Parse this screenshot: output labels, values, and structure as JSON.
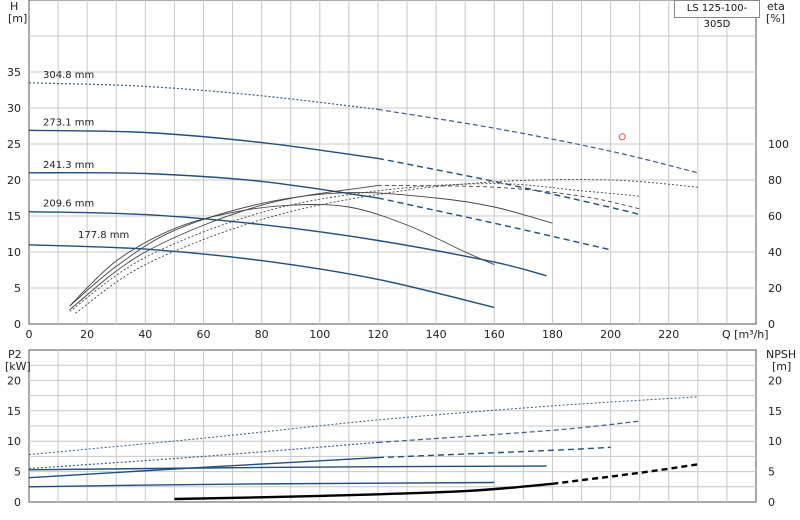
{
  "chart_data": [
    {
      "type": "line",
      "title": "",
      "model": "LS 125-100-305D",
      "xlabel": "Q [m³/h]",
      "x_tick_labels": [
        "0",
        "20",
        "40",
        "60",
        "80",
        "100",
        "120",
        "140",
        "160",
        "180",
        "200",
        "220"
      ],
      "xlim": [
        0,
        250
      ],
      "left_axis": {
        "label_line1": "H",
        "label_line2": "[m]",
        "ylim": [
          0,
          45
        ],
        "ticks": [
          0,
          5,
          10,
          15,
          20,
          25,
          30,
          35
        ]
      },
      "right_axis": {
        "label_line1": "eta",
        "label_line2": "[%]",
        "ylim": [
          0,
          180
        ],
        "ticks": [
          0,
          20,
          40,
          60,
          80,
          100
        ]
      },
      "grid": true,
      "series": [
        {
          "name": "304.8 mm",
          "axis": "left",
          "style": "dotted-dashed",
          "x": [
            0,
            40,
            80,
            120,
            160,
            200,
            230
          ],
          "y": [
            33.5,
            33.0,
            31.7,
            29.8,
            27.2,
            24.0,
            21.0
          ]
        },
        {
          "name": "273.1 mm",
          "axis": "left",
          "style": "solid-dashed",
          "x": [
            0,
            40,
            80,
            120,
            160,
            200,
            210
          ],
          "y": [
            26.9,
            26.6,
            25.2,
            23.0,
            19.8,
            16.2,
            15.2
          ]
        },
        {
          "name": "241.3 mm",
          "axis": "left",
          "style": "solid-dashed",
          "x": [
            0,
            40,
            80,
            120,
            160,
            200
          ],
          "y": [
            21.0,
            20.9,
            19.8,
            17.5,
            14.0,
            10.3
          ]
        },
        {
          "name": "209.6 mm",
          "axis": "left",
          "style": "solid",
          "x": [
            0,
            40,
            80,
            120,
            160,
            178
          ],
          "y": [
            15.6,
            15.2,
            13.8,
            11.6,
            8.6,
            6.7
          ]
        },
        {
          "name": "177.8 mm",
          "axis": "left",
          "style": "solid",
          "x": [
            0,
            40,
            80,
            120,
            160
          ],
          "y": [
            11.0,
            10.4,
            8.8,
            6.2,
            2.3
          ]
        },
        {
          "name": "",
          "axis": "right",
          "style": "eta-solid",
          "x": [
            14,
            30,
            50,
            70,
            90,
            110,
            130,
            150,
            160
          ],
          "y": [
            10,
            35,
            53,
            62,
            66,
            65,
            55,
            40,
            33
          ]
        },
        {
          "name": "",
          "axis": "right",
          "style": "eta-solid",
          "x": [
            14,
            30,
            50,
            80,
            110,
            140,
            160,
            180
          ],
          "y": [
            10,
            32,
            52,
            67,
            73,
            70,
            65,
            56
          ]
        },
        {
          "name": "",
          "axis": "right",
          "style": "eta-solid-dashed",
          "x": [
            14,
            40,
            80,
            120,
            160,
            190,
            210
          ],
          "y": [
            8,
            40,
            66,
            77,
            76,
            71,
            64
          ]
        },
        {
          "name": "",
          "axis": "right",
          "style": "eta-dotted",
          "x": [
            14,
            40,
            80,
            120,
            160,
            190,
            210
          ],
          "y": [
            7,
            37,
            62,
            74,
            78,
            74,
            71
          ]
        },
        {
          "name": "",
          "axis": "right",
          "style": "eta-dotted",
          "x": [
            16,
            40,
            80,
            120,
            160,
            200,
            230
          ],
          "y": [
            6,
            33,
            58,
            72,
            79,
            80,
            76
          ]
        }
      ],
      "duty_point": {
        "x": 204,
        "y": 26
      }
    },
    {
      "type": "line",
      "title": "",
      "left_axis": {
        "label_line1": "P2",
        "label_line2": "[kW]",
        "ylim": [
          0,
          25
        ],
        "ticks": [
          0,
          5,
          10,
          15,
          20
        ]
      },
      "right_axis": {
        "label_line1": "NPSH",
        "label_line2": "[m]",
        "ylim": [
          0,
          25
        ],
        "ticks": [
          0,
          5,
          10,
          15,
          20
        ]
      },
      "grid": true,
      "series": [
        {
          "name": "",
          "style": "dotted",
          "x": [
            0,
            60,
            120,
            180,
            230
          ],
          "y": [
            7.8,
            10.5,
            13.5,
            15.8,
            17.3
          ]
        },
        {
          "name": "",
          "style": "dotted-dashed",
          "x": [
            0,
            60,
            120,
            180,
            210
          ],
          "y": [
            5.5,
            7.5,
            9.8,
            11.8,
            13.3
          ]
        },
        {
          "name": "",
          "style": "solid-dashed",
          "x": [
            0,
            60,
            120,
            180,
            200
          ],
          "y": [
            4.0,
            5.7,
            7.3,
            8.5,
            9.0
          ]
        },
        {
          "name": "",
          "style": "solid",
          "x": [
            0,
            60,
            120,
            178
          ],
          "y": [
            5.3,
            5.6,
            5.8,
            5.9
          ]
        },
        {
          "name": "",
          "style": "solid",
          "x": [
            0,
            60,
            120,
            160
          ],
          "y": [
            2.5,
            2.9,
            3.1,
            3.2
          ]
        },
        {
          "name": "",
          "style": "npsh-thick",
          "x": [
            50,
            100,
            150,
            180,
            210,
            230
          ],
          "y": [
            0.5,
            1.0,
            1.8,
            3.0,
            4.8,
            6.2
          ]
        }
      ]
    }
  ],
  "colors": {
    "curve_blue": "#1f4f7f",
    "dotted": "#3b5a8a",
    "eta": "#444444",
    "grid": "#c8c8c8",
    "duty_point": "#e05050"
  }
}
